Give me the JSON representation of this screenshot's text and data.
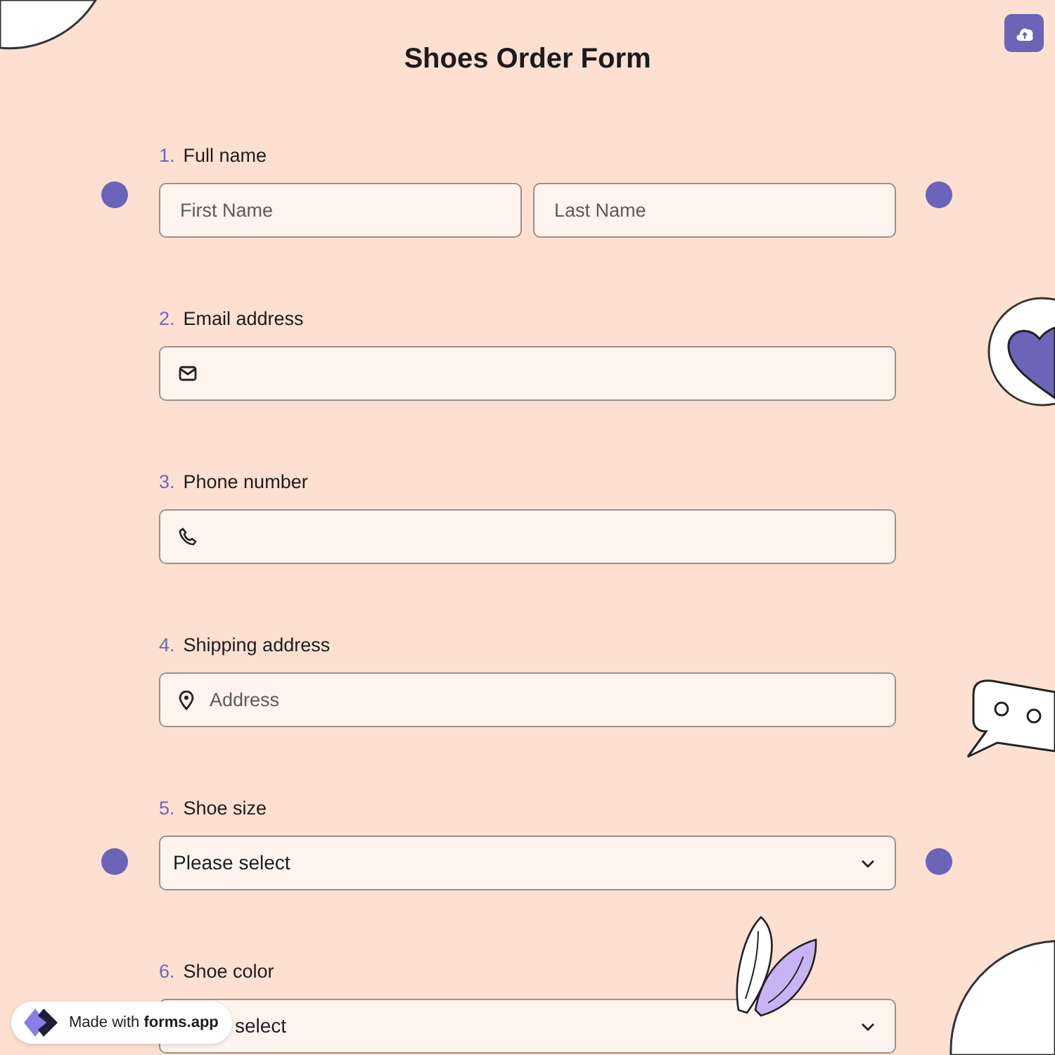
{
  "title": "Shoes Order Form",
  "questions": [
    {
      "number": "1.",
      "label": "Full name",
      "kind": "name",
      "fields": [
        {
          "placeholder": "First Name"
        },
        {
          "placeholder": "Last Name"
        }
      ]
    },
    {
      "number": "2.",
      "label": "Email address",
      "kind": "email"
    },
    {
      "number": "3.",
      "label": "Phone number",
      "kind": "phone"
    },
    {
      "number": "4.",
      "label": "Shipping address",
      "kind": "address",
      "fields": [
        {
          "placeholder": "Address"
        }
      ]
    },
    {
      "number": "5.",
      "label": "Shoe size",
      "kind": "select",
      "fields": [
        {
          "value": "Please select"
        }
      ]
    },
    {
      "number": "6.",
      "label": "Shoe color",
      "kind": "select",
      "fields": [
        {
          "value": "select",
          "covered": true
        }
      ]
    }
  ],
  "badge": "Made with **forms.app**"
}
